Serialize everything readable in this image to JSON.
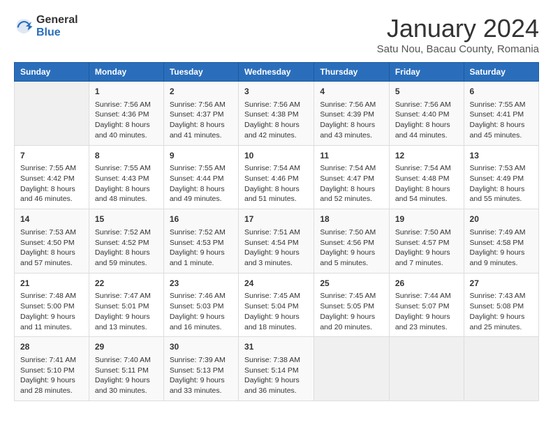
{
  "logo": {
    "general": "General",
    "blue": "Blue"
  },
  "title": "January 2024",
  "location": "Satu Nou, Bacau County, Romania",
  "headers": [
    "Sunday",
    "Monday",
    "Tuesday",
    "Wednesday",
    "Thursday",
    "Friday",
    "Saturday"
  ],
  "weeks": [
    [
      {
        "day": "",
        "sunrise": "",
        "sunset": "",
        "daylight": ""
      },
      {
        "day": "1",
        "sunrise": "Sunrise: 7:56 AM",
        "sunset": "Sunset: 4:36 PM",
        "daylight": "Daylight: 8 hours and 40 minutes."
      },
      {
        "day": "2",
        "sunrise": "Sunrise: 7:56 AM",
        "sunset": "Sunset: 4:37 PM",
        "daylight": "Daylight: 8 hours and 41 minutes."
      },
      {
        "day": "3",
        "sunrise": "Sunrise: 7:56 AM",
        "sunset": "Sunset: 4:38 PM",
        "daylight": "Daylight: 8 hours and 42 minutes."
      },
      {
        "day": "4",
        "sunrise": "Sunrise: 7:56 AM",
        "sunset": "Sunset: 4:39 PM",
        "daylight": "Daylight: 8 hours and 43 minutes."
      },
      {
        "day": "5",
        "sunrise": "Sunrise: 7:56 AM",
        "sunset": "Sunset: 4:40 PM",
        "daylight": "Daylight: 8 hours and 44 minutes."
      },
      {
        "day": "6",
        "sunrise": "Sunrise: 7:55 AM",
        "sunset": "Sunset: 4:41 PM",
        "daylight": "Daylight: 8 hours and 45 minutes."
      }
    ],
    [
      {
        "day": "7",
        "sunrise": "Sunrise: 7:55 AM",
        "sunset": "Sunset: 4:42 PM",
        "daylight": "Daylight: 8 hours and 46 minutes."
      },
      {
        "day": "8",
        "sunrise": "Sunrise: 7:55 AM",
        "sunset": "Sunset: 4:43 PM",
        "daylight": "Daylight: 8 hours and 48 minutes."
      },
      {
        "day": "9",
        "sunrise": "Sunrise: 7:55 AM",
        "sunset": "Sunset: 4:44 PM",
        "daylight": "Daylight: 8 hours and 49 minutes."
      },
      {
        "day": "10",
        "sunrise": "Sunrise: 7:54 AM",
        "sunset": "Sunset: 4:46 PM",
        "daylight": "Daylight: 8 hours and 51 minutes."
      },
      {
        "day": "11",
        "sunrise": "Sunrise: 7:54 AM",
        "sunset": "Sunset: 4:47 PM",
        "daylight": "Daylight: 8 hours and 52 minutes."
      },
      {
        "day": "12",
        "sunrise": "Sunrise: 7:54 AM",
        "sunset": "Sunset: 4:48 PM",
        "daylight": "Daylight: 8 hours and 54 minutes."
      },
      {
        "day": "13",
        "sunrise": "Sunrise: 7:53 AM",
        "sunset": "Sunset: 4:49 PM",
        "daylight": "Daylight: 8 hours and 55 minutes."
      }
    ],
    [
      {
        "day": "14",
        "sunrise": "Sunrise: 7:53 AM",
        "sunset": "Sunset: 4:50 PM",
        "daylight": "Daylight: 8 hours and 57 minutes."
      },
      {
        "day": "15",
        "sunrise": "Sunrise: 7:52 AM",
        "sunset": "Sunset: 4:52 PM",
        "daylight": "Daylight: 8 hours and 59 minutes."
      },
      {
        "day": "16",
        "sunrise": "Sunrise: 7:52 AM",
        "sunset": "Sunset: 4:53 PM",
        "daylight": "Daylight: 9 hours and 1 minute."
      },
      {
        "day": "17",
        "sunrise": "Sunrise: 7:51 AM",
        "sunset": "Sunset: 4:54 PM",
        "daylight": "Daylight: 9 hours and 3 minutes."
      },
      {
        "day": "18",
        "sunrise": "Sunrise: 7:50 AM",
        "sunset": "Sunset: 4:56 PM",
        "daylight": "Daylight: 9 hours and 5 minutes."
      },
      {
        "day": "19",
        "sunrise": "Sunrise: 7:50 AM",
        "sunset": "Sunset: 4:57 PM",
        "daylight": "Daylight: 9 hours and 7 minutes."
      },
      {
        "day": "20",
        "sunrise": "Sunrise: 7:49 AM",
        "sunset": "Sunset: 4:58 PM",
        "daylight": "Daylight: 9 hours and 9 minutes."
      }
    ],
    [
      {
        "day": "21",
        "sunrise": "Sunrise: 7:48 AM",
        "sunset": "Sunset: 5:00 PM",
        "daylight": "Daylight: 9 hours and 11 minutes."
      },
      {
        "day": "22",
        "sunrise": "Sunrise: 7:47 AM",
        "sunset": "Sunset: 5:01 PM",
        "daylight": "Daylight: 9 hours and 13 minutes."
      },
      {
        "day": "23",
        "sunrise": "Sunrise: 7:46 AM",
        "sunset": "Sunset: 5:03 PM",
        "daylight": "Daylight: 9 hours and 16 minutes."
      },
      {
        "day": "24",
        "sunrise": "Sunrise: 7:45 AM",
        "sunset": "Sunset: 5:04 PM",
        "daylight": "Daylight: 9 hours and 18 minutes."
      },
      {
        "day": "25",
        "sunrise": "Sunrise: 7:45 AM",
        "sunset": "Sunset: 5:05 PM",
        "daylight": "Daylight: 9 hours and 20 minutes."
      },
      {
        "day": "26",
        "sunrise": "Sunrise: 7:44 AM",
        "sunset": "Sunset: 5:07 PM",
        "daylight": "Daylight: 9 hours and 23 minutes."
      },
      {
        "day": "27",
        "sunrise": "Sunrise: 7:43 AM",
        "sunset": "Sunset: 5:08 PM",
        "daylight": "Daylight: 9 hours and 25 minutes."
      }
    ],
    [
      {
        "day": "28",
        "sunrise": "Sunrise: 7:41 AM",
        "sunset": "Sunset: 5:10 PM",
        "daylight": "Daylight: 9 hours and 28 minutes."
      },
      {
        "day": "29",
        "sunrise": "Sunrise: 7:40 AM",
        "sunset": "Sunset: 5:11 PM",
        "daylight": "Daylight: 9 hours and 30 minutes."
      },
      {
        "day": "30",
        "sunrise": "Sunrise: 7:39 AM",
        "sunset": "Sunset: 5:13 PM",
        "daylight": "Daylight: 9 hours and 33 minutes."
      },
      {
        "day": "31",
        "sunrise": "Sunrise: 7:38 AM",
        "sunset": "Sunset: 5:14 PM",
        "daylight": "Daylight: 9 hours and 36 minutes."
      },
      {
        "day": "",
        "sunrise": "",
        "sunset": "",
        "daylight": ""
      },
      {
        "day": "",
        "sunrise": "",
        "sunset": "",
        "daylight": ""
      },
      {
        "day": "",
        "sunrise": "",
        "sunset": "",
        "daylight": ""
      }
    ]
  ]
}
